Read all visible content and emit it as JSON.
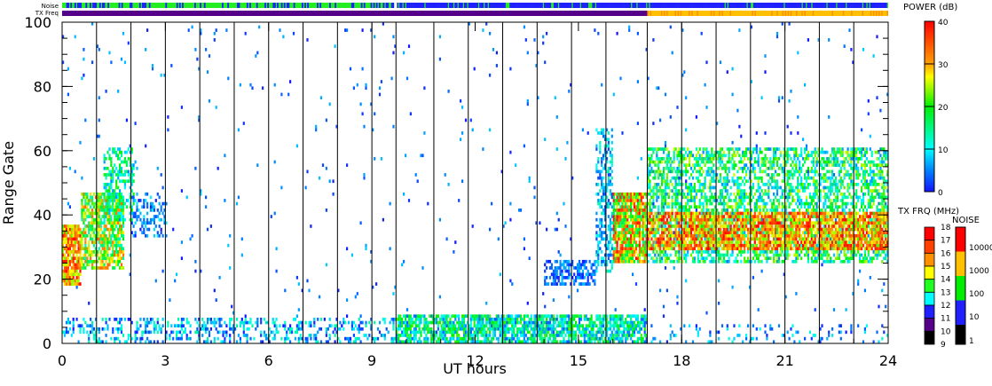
{
  "header": {
    "noise_label": "Noise",
    "txfreq_label": "TX Freq"
  },
  "chart_data": {
    "type": "heatmap",
    "title": "",
    "xlabel": "UT hours",
    "ylabel": "Range Gate",
    "xlim": [
      0,
      24
    ],
    "ylim": [
      0,
      100
    ],
    "xticks": [
      "0",
      "3",
      "6",
      "9",
      "12",
      "15",
      "18",
      "21",
      "24"
    ],
    "yticks": [
      "0",
      "20",
      "40",
      "60",
      "80",
      "100"
    ],
    "scan_boundaries_hours": [
      1,
      2,
      3,
      4,
      5,
      6,
      7,
      8,
      9,
      9.7,
      10.8,
      11.8,
      12.8,
      13.8,
      14.8,
      15.8,
      17,
      18,
      19,
      20,
      21,
      22,
      23
    ],
    "echo_regions": [
      {
        "t0": 0,
        "t1": 0.5,
        "g0": 18,
        "g1": 36,
        "pmin": 22,
        "pmax": 40,
        "density": 0.9
      },
      {
        "t0": 0.5,
        "t1": 1.8,
        "g0": 23,
        "g1": 46,
        "pmin": 12,
        "pmax": 34,
        "density": 0.75
      },
      {
        "t0": 1.2,
        "t1": 2.1,
        "g0": 38,
        "g1": 60,
        "pmin": 5,
        "pmax": 22,
        "density": 0.45
      },
      {
        "t0": 2,
        "t1": 3,
        "g0": 33,
        "g1": 46,
        "pmin": 0,
        "pmax": 10,
        "density": 0.35
      },
      {
        "t0": 0,
        "t1": 9.7,
        "g0": 0,
        "g1": 7,
        "pmin": 0,
        "pmax": 14,
        "density": 0.3
      },
      {
        "t0": 9.7,
        "t1": 17,
        "g0": 0,
        "g1": 8,
        "pmin": 3,
        "pmax": 22,
        "density": 0.75
      },
      {
        "t0": 17,
        "t1": 24,
        "g0": 0,
        "g1": 5,
        "pmin": 0,
        "pmax": 12,
        "density": 0.12
      },
      {
        "t0": 14,
        "t1": 15.5,
        "g0": 18,
        "g1": 25,
        "pmin": 0,
        "pmax": 8,
        "density": 0.6
      },
      {
        "t0": 15.5,
        "t1": 16,
        "g0": 22,
        "g1": 66,
        "pmin": 2,
        "pmax": 14,
        "density": 0.45
      },
      {
        "t0": 16,
        "t1": 17,
        "g0": 25,
        "g1": 46,
        "pmin": 14,
        "pmax": 40,
        "density": 0.85
      },
      {
        "t0": 17,
        "t1": 24,
        "g0": 25,
        "g1": 60,
        "pmin": 5,
        "pmax": 26,
        "density": 0.55
      },
      {
        "t0": 17,
        "t1": 24,
        "g0": 29,
        "g1": 40,
        "pmin": 22,
        "pmax": 40,
        "density": 0.8
      }
    ],
    "background_scatter": {
      "density": 0.012,
      "pmin": 0,
      "pmax": 8
    },
    "colorbars": {
      "power": {
        "title": "POWER (dB)",
        "range": [
          0,
          40
        ],
        "ticks": [
          "40",
          "30",
          "20",
          "10",
          "0"
        ]
      },
      "tx_freq": {
        "title": "TX FRQ (MHz)",
        "ticks": [
          "18",
          "17",
          "16",
          "15",
          "14",
          "13",
          "12",
          "11",
          "10",
          "9"
        ],
        "colors": [
          "#ff0000",
          "#ff4000",
          "#ff9000",
          "#ffff00",
          "#20ff20",
          "#00ffff",
          "#2020ff",
          "#550088",
          "#000000"
        ]
      },
      "noise": {
        "title": "NOISE",
        "ticks": [
          "10000",
          "1000",
          "100",
          "10",
          "1"
        ],
        "colors": [
          "#ff0000",
          "#ffc000",
          "#00ee00",
          "#2020ff",
          "#000000"
        ]
      }
    },
    "tx_freq_bar": [
      {
        "t0": 0,
        "t1": 17,
        "color": "#550088"
      },
      {
        "t0": 17,
        "t1": 24,
        "color": "#ffc000"
      }
    ],
    "noise_bar_colors": {
      "low": "#22ee22",
      "high": "#2020ff"
    }
  }
}
